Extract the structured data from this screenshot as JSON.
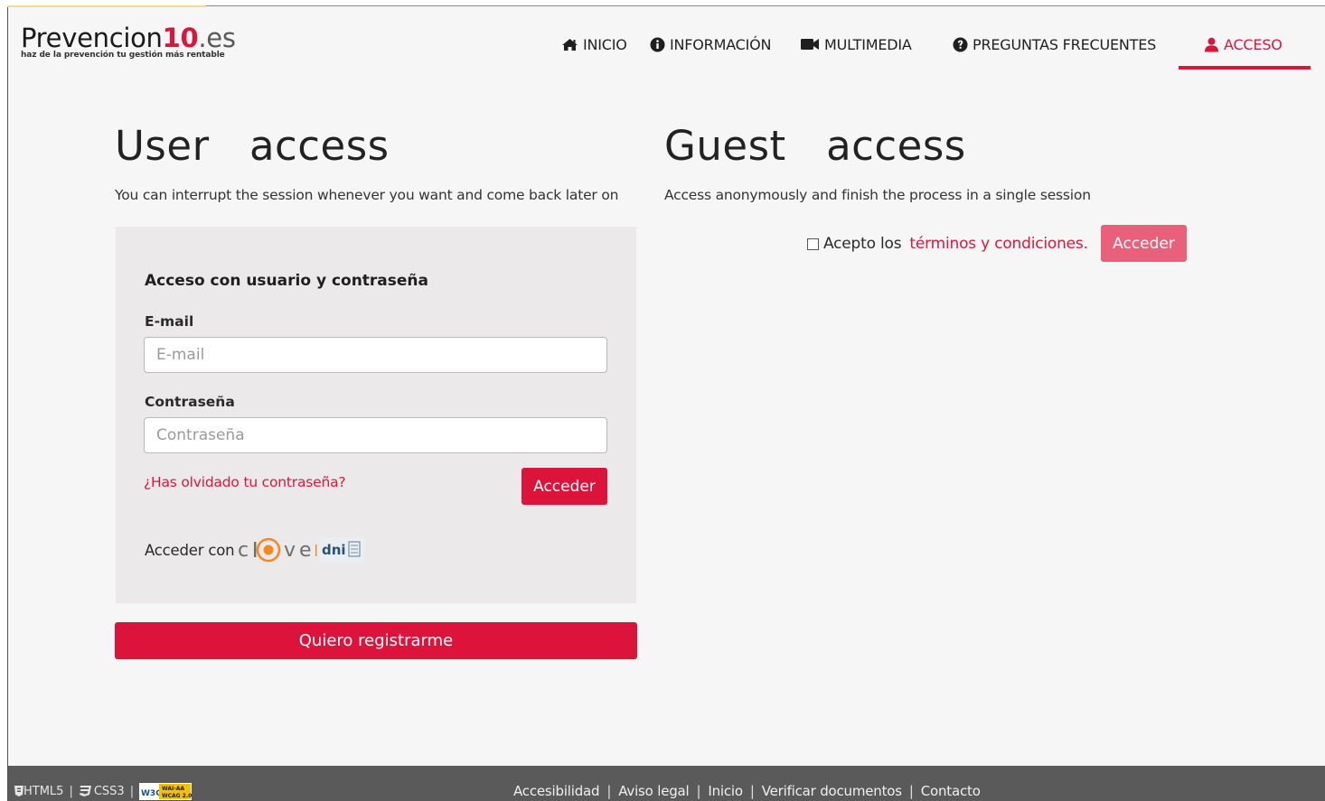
{
  "brand": {
    "name_prefix": "Prevencion",
    "name_number": "10",
    "name_tld": ".es",
    "tagline": "haz de la prevención tu gestión más rentable"
  },
  "nav": {
    "items": [
      {
        "label": "INICIO",
        "icon": "home-icon"
      },
      {
        "label": "INFORMACIÓN",
        "icon": "info-icon"
      },
      {
        "label": "MULTIMEDIA",
        "icon": "video-camera-icon"
      },
      {
        "label": "PREGUNTAS FRECUENTES",
        "icon": "question-icon"
      },
      {
        "label": "ACCESO",
        "icon": "user-icon",
        "active": true
      }
    ]
  },
  "user_access": {
    "title": "User   access",
    "subtitle": "You can interrupt the session whenever you want and come back later on",
    "card_title": "Acceso con usuario y contraseña",
    "email_label": "E-mail",
    "email_placeholder": "E-mail",
    "email_value": "",
    "password_label": "Contraseña",
    "password_placeholder": "Contraseña",
    "password_value": "",
    "forgot_link": "¿Has olvidado tu contraseña?",
    "login_button": "Acceder",
    "clave_label": "Acceder con",
    "clave_logo_text": "cl@ve",
    "dni_logo_text": "dni",
    "register_button": "Quiero registrarme"
  },
  "guest_access": {
    "title": "Guest   access",
    "subtitle": "Access anonymously and finish the process in a single session",
    "accept_text": "Acepto los",
    "terms_link": "términos y condiciones.",
    "checkbox_checked": false,
    "button": "Acceder"
  },
  "footer": {
    "badges": [
      "HTML5",
      "CSS3",
      "W3C WAI-AA WCAG 2.0"
    ],
    "links": [
      "Accesibilidad",
      "Aviso legal",
      "Inicio",
      "Verificar documentos",
      "Contacto"
    ]
  },
  "colors": {
    "accent": "#d8173c",
    "button": "#dc143c",
    "button_disabled": "#e8607a",
    "card_bg": "#ebe9e9",
    "page_bg": "#f6f6f6",
    "footer_bg": "#5a5a5a"
  }
}
